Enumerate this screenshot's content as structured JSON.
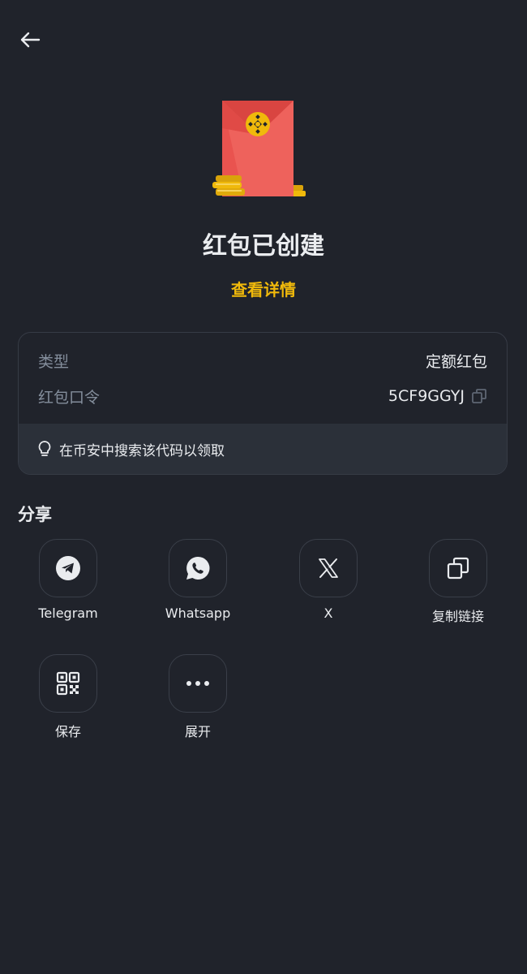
{
  "header": {
    "back_icon": "arrow-left-icon"
  },
  "hero": {
    "image": "red-envelope-with-coins",
    "envelope_color": "#e9534f",
    "coin_color": "#f0b90b"
  },
  "title": "红包已创建",
  "details_link": "查看详情",
  "info": {
    "type_label": "类型",
    "type_value": "定额红包",
    "code_label": "红包口令",
    "code_value": "5CF9GGYJ",
    "hint": "在币安中搜索该代码以领取"
  },
  "share": {
    "title": "分享",
    "items": [
      {
        "label": "Telegram",
        "icon": "telegram-icon"
      },
      {
        "label": "Whatsapp",
        "icon": "whatsapp-icon"
      },
      {
        "label": "X",
        "icon": "x-icon"
      },
      {
        "label": "复制链接",
        "icon": "copy-icon"
      },
      {
        "label": "保存",
        "icon": "qr-code-icon"
      },
      {
        "label": "展开",
        "icon": "more-icon"
      }
    ]
  },
  "colors": {
    "background": "#20232b",
    "accent": "#f0b90b",
    "text_secondary": "#848e9c"
  }
}
